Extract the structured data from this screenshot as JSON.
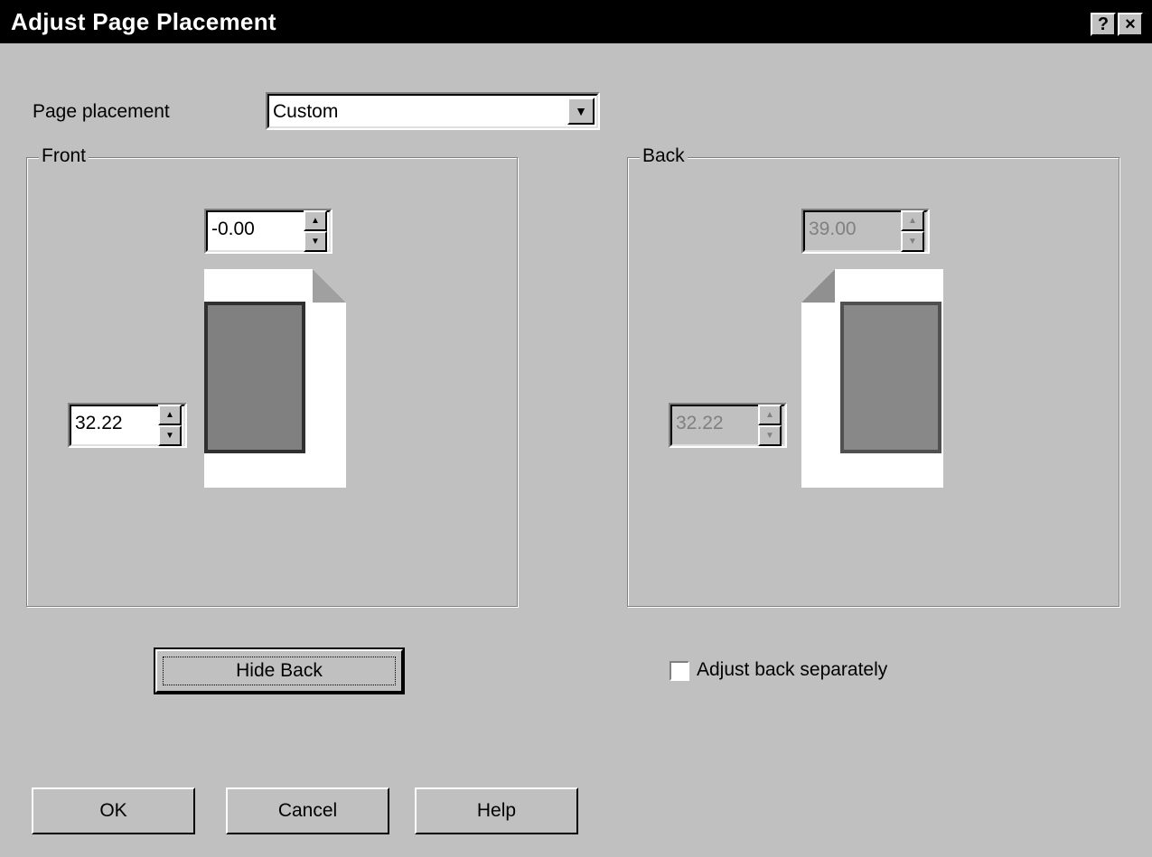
{
  "window": {
    "title": "Adjust Page Placement",
    "help_glyph": "?",
    "close_glyph": "×"
  },
  "placement": {
    "label": "Page placement",
    "selected": "Custom",
    "dropdown_glyph": "▼"
  },
  "front": {
    "label": "Front",
    "top_value": "-0.00",
    "left_value": "32.22"
  },
  "back": {
    "label": "Back",
    "top_value": "39.00",
    "left_value": "32.22"
  },
  "spin_glyphs": {
    "up": "▲",
    "down": "▼"
  },
  "buttons": {
    "hide_back": "Hide Back",
    "ok": "OK",
    "cancel": "Cancel",
    "help": "Help"
  },
  "adjust_back": {
    "label": "Adjust back separately",
    "checked": false
  },
  "colors": {
    "dialog_bg": "#c0c0c0",
    "title_bg": "#000000",
    "page_bg": "#ffffff",
    "content_fill": "#808080"
  }
}
